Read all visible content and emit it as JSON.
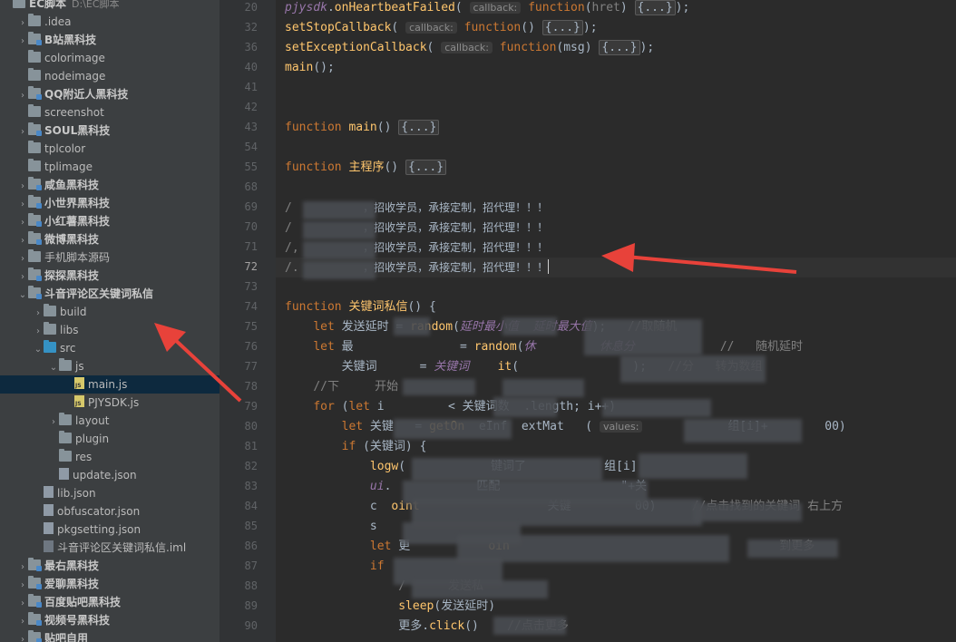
{
  "project": {
    "name": "EC脚本",
    "path": "D:\\EC脚本"
  },
  "tree": [
    {
      "label": "EC脚本",
      "kind": "root",
      "depth": 0,
      "arrow": "",
      "extra": "D:\\EC脚本"
    },
    {
      "label": ".idea",
      "kind": "folder",
      "depth": 1,
      "arrow": "›"
    },
    {
      "label": "B站黑科技",
      "kind": "module",
      "depth": 1,
      "arrow": "›",
      "bold": true
    },
    {
      "label": "colorimage",
      "kind": "folder",
      "depth": 1,
      "arrow": ""
    },
    {
      "label": "nodeimage",
      "kind": "folder",
      "depth": 1,
      "arrow": ""
    },
    {
      "label": "QQ附近人黑科技",
      "kind": "module",
      "depth": 1,
      "arrow": "›",
      "bold": true
    },
    {
      "label": "screenshot",
      "kind": "folder",
      "depth": 1,
      "arrow": ""
    },
    {
      "label": "SOUL黑科技",
      "kind": "module",
      "depth": 1,
      "arrow": "›",
      "bold": true
    },
    {
      "label": "tplcolor",
      "kind": "folder",
      "depth": 1,
      "arrow": ""
    },
    {
      "label": "tplimage",
      "kind": "folder",
      "depth": 1,
      "arrow": ""
    },
    {
      "label": "咸鱼黑科技",
      "kind": "module",
      "depth": 1,
      "arrow": "›",
      "bold": true
    },
    {
      "label": "小世界黑科技",
      "kind": "module",
      "depth": 1,
      "arrow": "›",
      "bold": true
    },
    {
      "label": "小红薯黑科技",
      "kind": "module",
      "depth": 1,
      "arrow": "›",
      "bold": true
    },
    {
      "label": "微博黑科技",
      "kind": "module",
      "depth": 1,
      "arrow": "›",
      "bold": true
    },
    {
      "label": "手机脚本源码",
      "kind": "folder",
      "depth": 1,
      "arrow": "›"
    },
    {
      "label": "探探黑科技",
      "kind": "module",
      "depth": 1,
      "arrow": "›",
      "bold": true
    },
    {
      "label": "斗音评论区关键词私信",
      "kind": "module",
      "depth": 1,
      "arrow": "⌄",
      "bold": true
    },
    {
      "label": "build",
      "kind": "folder",
      "depth": 2,
      "arrow": "›"
    },
    {
      "label": "libs",
      "kind": "folder",
      "depth": 2,
      "arrow": "›"
    },
    {
      "label": "src",
      "kind": "folderblue",
      "depth": 2,
      "arrow": "⌄"
    },
    {
      "label": "js",
      "kind": "folder",
      "depth": 3,
      "arrow": "⌄"
    },
    {
      "label": "main.js",
      "kind": "jsfile",
      "depth": 4,
      "arrow": "",
      "selected": true
    },
    {
      "label": "PJYSDK.js",
      "kind": "jsfile",
      "depth": 4,
      "arrow": ""
    },
    {
      "label": "layout",
      "kind": "folder",
      "depth": 3,
      "arrow": "›"
    },
    {
      "label": "plugin",
      "kind": "folder",
      "depth": 3,
      "arrow": ""
    },
    {
      "label": "res",
      "kind": "folder",
      "depth": 3,
      "arrow": ""
    },
    {
      "label": "update.json",
      "kind": "jsonfile",
      "depth": 3,
      "arrow": ""
    },
    {
      "label": "lib.json",
      "kind": "jsonfile",
      "depth": 2,
      "arrow": ""
    },
    {
      "label": "obfuscator.json",
      "kind": "jsonfile",
      "depth": 2,
      "arrow": ""
    },
    {
      "label": "pkgsetting.json",
      "kind": "jsonfile",
      "depth": 2,
      "arrow": ""
    },
    {
      "label": "斗音评论区关键词私信.iml",
      "kind": "imlfile",
      "depth": 2,
      "arrow": ""
    },
    {
      "label": "最右黑科技",
      "kind": "module",
      "depth": 1,
      "arrow": "›",
      "bold": true
    },
    {
      "label": "爱聊黑科技",
      "kind": "module",
      "depth": 1,
      "arrow": "›",
      "bold": true
    },
    {
      "label": "百度贴吧黑科技",
      "kind": "module",
      "depth": 1,
      "arrow": "›",
      "bold": true
    },
    {
      "label": "视频号黑科技",
      "kind": "module",
      "depth": 1,
      "arrow": "›",
      "bold": true
    },
    {
      "label": "贴吧自用",
      "kind": "module",
      "depth": 1,
      "arrow": "›",
      "bold": true
    }
  ],
  "line_numbers": [
    "20",
    "32",
    "36",
    "40",
    "41",
    "42",
    "43",
    "54",
    "55",
    "68",
    "69",
    "70",
    "71",
    "72",
    "73",
    "74",
    "75",
    "76",
    "77",
    "78",
    "79",
    "80",
    "81",
    "82",
    "83",
    "84",
    "85",
    "86",
    "87",
    "88",
    "89",
    "90"
  ],
  "current_line": "72",
  "code": [
    {
      "html": "<span class='it'>pjysdk</span>.<span class='fn'>onHeartbeatFailed</span>( <span class='hint'>callback:</span> <span class='kw'>function</span>(<span class='cm'>hret</span>) <span class='fold'>{...}</span>);"
    },
    {
      "html": "<span class='fn'>setStopCallback</span>( <span class='hint'>callback:</span> <span class='kw'>function</span>() <span class='fold'>{...}</span>);"
    },
    {
      "html": "<span class='fn'>setExceptionCallback</span>( <span class='hint'>callback:</span> <span class='kw'>function</span>(msg) <span class='fold'>{...}</span>);"
    },
    {
      "html": "<span class='fn'>main</span>();"
    },
    {
      "html": ""
    },
    {
      "html": ""
    },
    {
      "html": "<span class='kw'>function</span> <span class='fn'>main</span>() <span class='fold'>{...}</span>"
    },
    {
      "html": ""
    },
    {
      "html": "<span class='kw'>function</span> <span class='fn'>主程序</span>() <span class='fold'>{...}</span>"
    },
    {
      "html": ""
    },
    {
      "html": "<span class='cm'>/          </span><span class='cn'>，招收学员，承接定制，招代理！！！</span>"
    },
    {
      "html": "<span class='cm'>/          </span><span class='cn'>，招收学员，承接定制，招代理！！！</span>"
    },
    {
      "html": "<span class='cm'>/,         </span><span class='cn'>，招收学员，承接定制，招代理！！！</span>"
    },
    {
      "html": "<span class='cm'>/.         </span><span class='cn'>，招收学员，承接定制，招代理！！！</span><span class='caret'></span>"
    },
    {
      "html": ""
    },
    {
      "html": "<span class='kw'>function</span> <span class='fn'>关键词私信</span>() {"
    },
    {
      "html": "    <span class='kw'>let</span> 发送延时 = <span class='fn'>random</span>(<span class='it'>延时最小值</span>  <span class='it'>延时最大值</span>);   <span class='cm'>//取随机</span>"
    },
    {
      "html": "    <span class='kw'>let</span> 最               = <span class='fn'>random</span>(<span class='it'>休         休息分</span>            <span class='cm'>//   随机延时</span>"
    },
    {
      "html": "        关键词      = <span class='it'>关键词</span>    <span class='fn'>it</span>(                );   <span class='cm'>//分   转为数组</span>"
    },
    {
      "html": "    <span class='cm'>//下     开始</span>"
    },
    {
      "html": "    <span class='kw'>for</span> (<span class='kw'>let</span> i         < 关键词数  .length; i++)"
    },
    {
      "html": "        <span class='kw'>let</span> 关键   = <span class='fn'>getOn</span>  eInf  extMat   ( <span class='hint'>values:</span>            组[i]+        00)"
    },
    {
      "html": "        <span class='kw'>if</span> (关键词) {"
    },
    {
      "html": "            <span class='fn'>logw</span>(            键词了           组[i]"
    },
    {
      "html": "            <span class='it'>ui</span>.            匹配                 \"+关"
    },
    {
      "html": "            c  <span class='fn'>oint</span>                  关键         00)     <span class='cm'>//点击找到的关键词 右上方</span>"
    },
    {
      "html": "            s"
    },
    {
      "html": "            <span class='kw'>let</span> 更           <span class='fn'>oin</span>                                      <span class='cm'>到更多</span>"
    },
    {
      "html": "            <span class='kw'>if</span>"
    },
    {
      "html": "                <span class='cm'>/      发送私</span>"
    },
    {
      "html": "                <span class='fn'>sleep</span>(发送延时)"
    },
    {
      "html": "                更多.<span class='fn'>click</span>()    <span class='cm'>//点击更多</span>"
    }
  ]
}
